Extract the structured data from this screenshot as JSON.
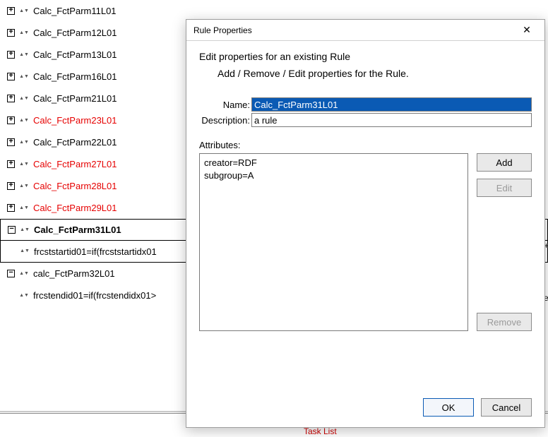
{
  "tree": {
    "items": [
      {
        "label": "Calc_FctParm11L01",
        "red": false,
        "expanded": false
      },
      {
        "label": "Calc_FctParm12L01",
        "red": false,
        "expanded": false
      },
      {
        "label": "Calc_FctParm13L01",
        "red": false,
        "expanded": false
      },
      {
        "label": "Calc_FctParm16L01",
        "red": false,
        "expanded": false
      },
      {
        "label": "Calc_FctParm21L01",
        "red": false,
        "expanded": false
      },
      {
        "label": "Calc_FctParm23L01",
        "red": true,
        "expanded": false
      },
      {
        "label": "Calc_FctParm22L01",
        "red": false,
        "expanded": false
      },
      {
        "label": "Calc_FctParm27L01",
        "red": true,
        "expanded": false
      },
      {
        "label": "Calc_FctParm28L01",
        "red": true,
        "expanded": false
      },
      {
        "label": "Calc_FctParm29L01",
        "red": true,
        "expanded": false
      }
    ],
    "selected": {
      "label": "Calc_FctParm31L01",
      "child": "frcststartid01=if(frcststartidx01"
    },
    "after": {
      "label": "calc_FctParm32L01",
      "child": "frcstendid01=if(frcstendidx01>"
    }
  },
  "tasklist": "Task List",
  "cut_right": {
    "a": "+",
    "b": "ep"
  },
  "dialog": {
    "title": "Rule Properties",
    "heading": "Edit properties for an existing Rule",
    "subheading": "Add / Remove / Edit properties for the Rule.",
    "name_label": "Name:",
    "name_value": "Calc_FctParm31L01",
    "desc_label": "Description:",
    "desc_value": "a rule",
    "attr_label": "Attributes:",
    "attributes": [
      "creator=RDF",
      "subgroup=A"
    ],
    "buttons": {
      "add": "Add",
      "edit": "Edit",
      "remove": "Remove",
      "ok": "OK",
      "cancel": "Cancel"
    }
  }
}
